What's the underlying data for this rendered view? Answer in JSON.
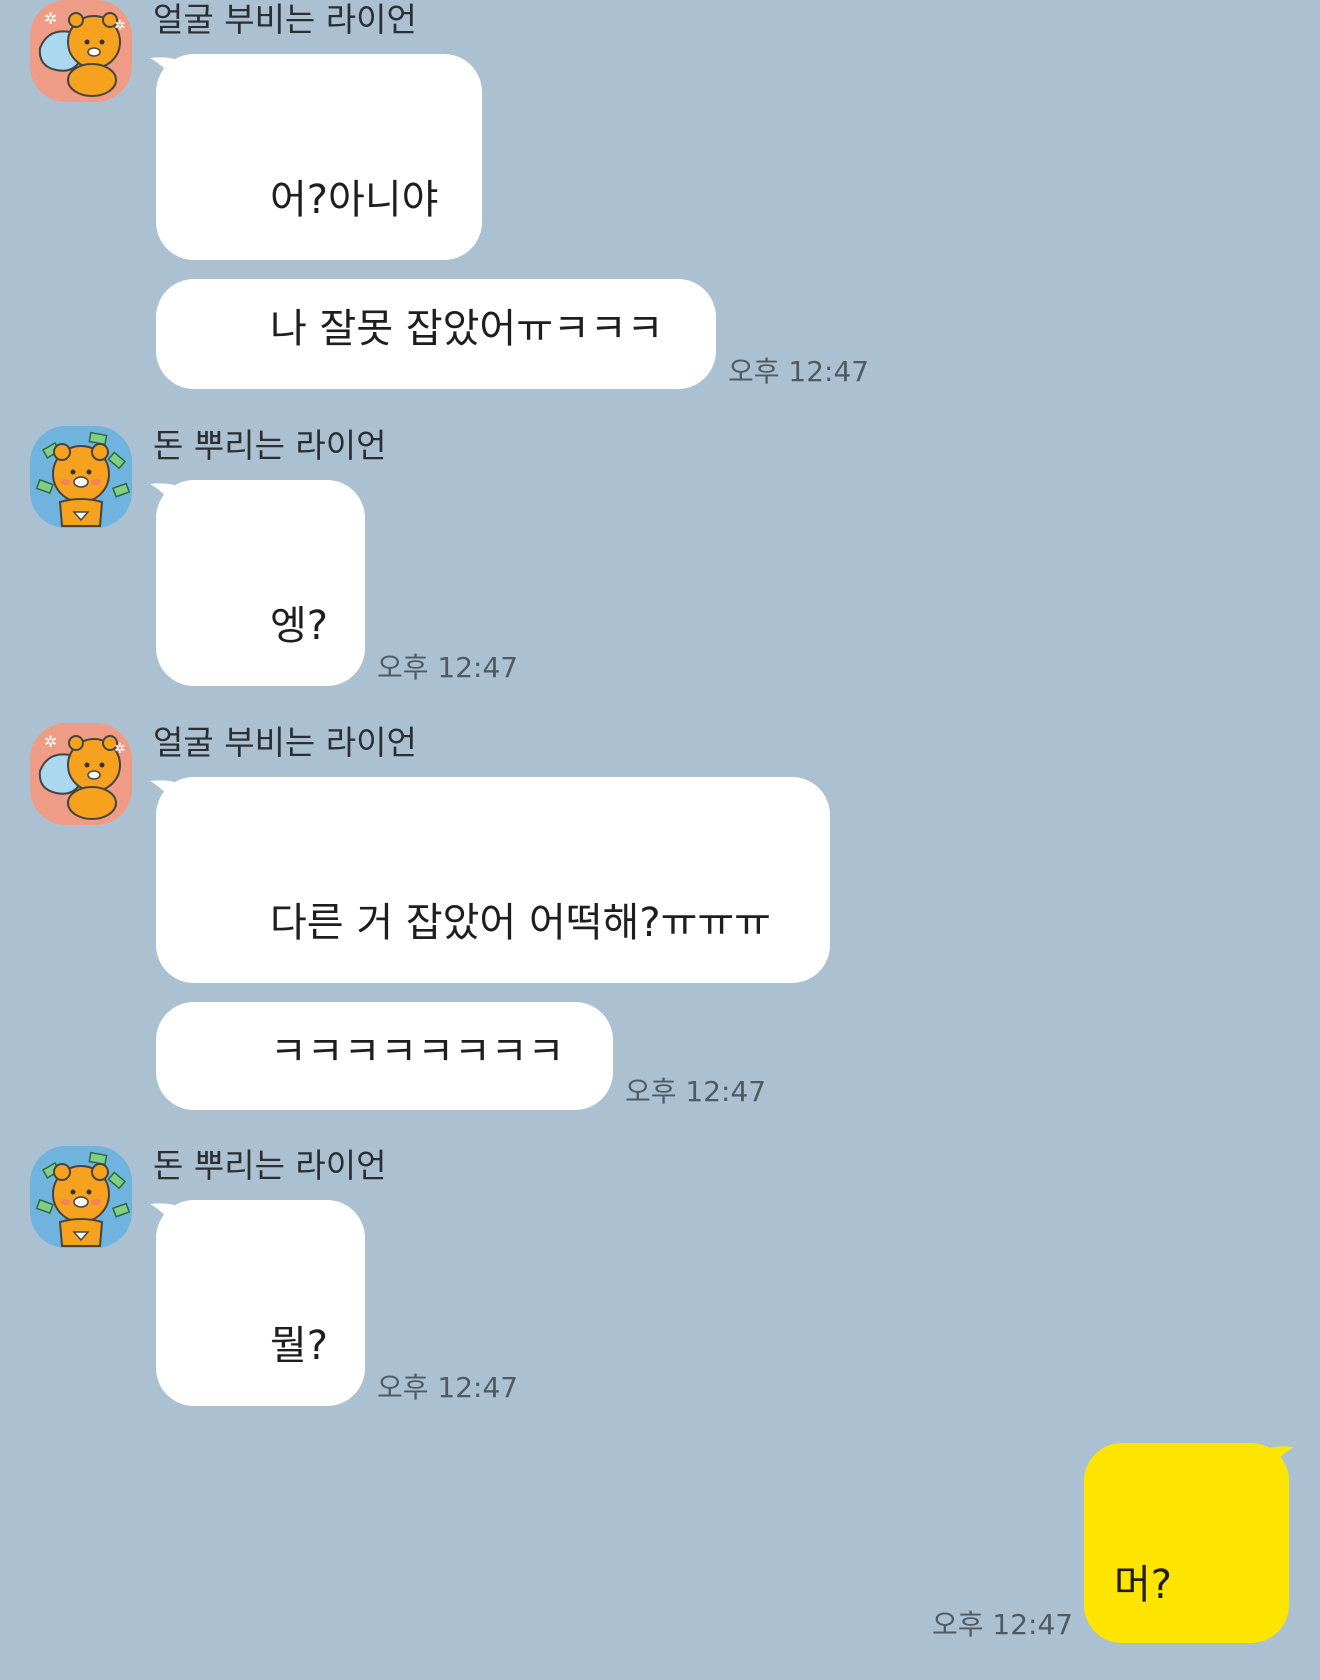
{
  "chat": {
    "background_color": "#abc1d1",
    "bubble_color": "#ffffff",
    "my_bubble_color": "#fee500",
    "groups": [
      {
        "sender": "얼굴 부비는 라이언",
        "avatar_icon": "ryan-pillow-avatar-icon",
        "messages": [
          "어?아니야",
          "나 잘못 잡았어ㅠㅋㅋㅋ"
        ],
        "time": "오후 12:47"
      },
      {
        "sender": "돈 뿌리는 라이언",
        "avatar_icon": "ryan-money-avatar-icon",
        "messages": [
          "엥?"
        ],
        "time": "오후 12:47"
      },
      {
        "sender": "얼굴 부비는 라이언",
        "avatar_icon": "ryan-pillow-avatar-icon",
        "messages": [
          "다른 거 잡았어 어떡해?ㅠㅠㅠ",
          "ㅋㅋㅋㅋㅋㅋㅋㅋ"
        ],
        "time": "오후 12:47"
      },
      {
        "sender": "돈 뿌리는 라이언",
        "avatar_icon": "ryan-money-avatar-icon",
        "messages": [
          "뭘?"
        ],
        "time": "오후 12:47"
      }
    ],
    "my_message": {
      "text": "머?",
      "time": "오후 12:47"
    }
  }
}
